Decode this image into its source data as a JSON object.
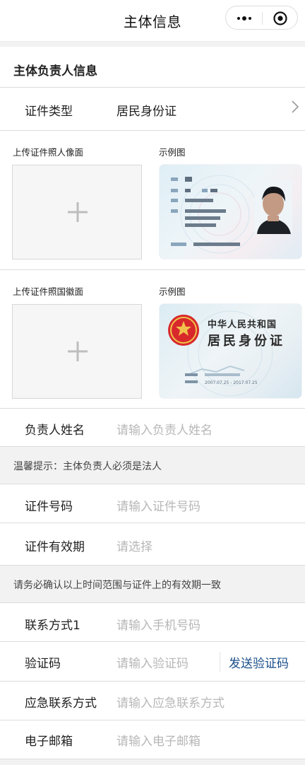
{
  "nav": {
    "title": "主体信息",
    "more_icon": "more-dots-icon",
    "close_icon": "target-circle-icon"
  },
  "section": {
    "title": "主体负责人信息"
  },
  "cert_type": {
    "label": "证件类型",
    "value": "居民身份证"
  },
  "upload_front": {
    "label": "上传证件照人像面",
    "sample_label": "示例图"
  },
  "upload_back": {
    "label": "上传证件照国徽面",
    "sample_label": "示例图"
  },
  "sample_back_card": {
    "line1": "中华人民共和国",
    "line2": "居民身份证"
  },
  "name_field": {
    "label": "负责人姓名",
    "placeholder": "请输入负责人姓名"
  },
  "notice1": "温馨提示：主体负责人必须是法人",
  "id_number": {
    "label": "证件号码",
    "placeholder": "请输入证件号码"
  },
  "validity": {
    "label": "证件有效期",
    "placeholder": "请选择"
  },
  "notice2": "请务必确认以上时间范围与证件上的有效期一致",
  "phone": {
    "label": "联系方式1",
    "placeholder": "请输入手机号码"
  },
  "verify_code": {
    "label": "验证码",
    "placeholder": "请输入验证码",
    "send_label": "发送验证码"
  },
  "emergency": {
    "label": "应急联系方式",
    "placeholder": "请输入应急联系方式"
  },
  "email": {
    "label": "电子邮箱",
    "placeholder": "请输入电子邮箱"
  },
  "colors": {
    "accent": "#1a4f8a",
    "placeholder": "#b7b7b7",
    "background": "#f2f2f2"
  }
}
